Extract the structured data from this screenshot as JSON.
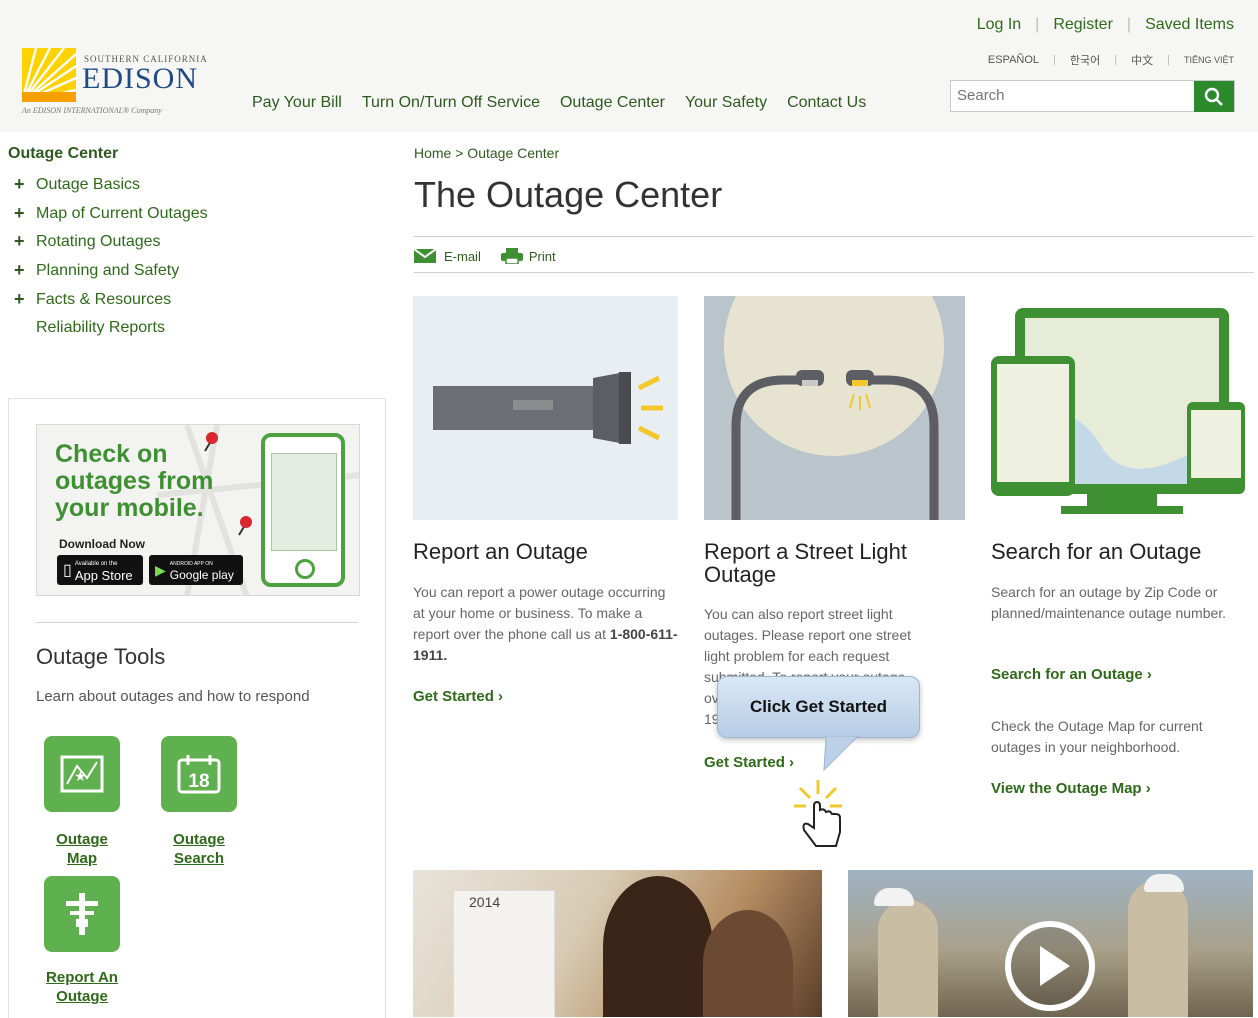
{
  "header": {
    "logo": {
      "small_top": "SOUTHERN CALIFORNIA",
      "brand": "EDISON",
      "tagline": "An EDISON INTERNATIONAL® Company"
    },
    "util_links": [
      "Log In",
      "Register",
      "Saved Items"
    ],
    "languages": [
      "ESPAÑOL",
      "한국어",
      "中文",
      "TIẾNG VIỆT"
    ],
    "nav": [
      "Pay Your Bill",
      "Turn On/Turn Off Service",
      "Outage Center",
      "Your Safety",
      "Contact Us"
    ],
    "search": {
      "placeholder": "Search",
      "icon": "search-icon"
    }
  },
  "sidebar": {
    "title": "Outage Center",
    "items": [
      {
        "label": "Outage Basics",
        "expandable": true
      },
      {
        "label": "Map of Current Outages",
        "expandable": true
      },
      {
        "label": "Rotating Outages",
        "expandable": true
      },
      {
        "label": "Planning and Safety",
        "expandable": true
      },
      {
        "label": "Facts & Resources",
        "expandable": true
      },
      {
        "label": "Reliability Reports",
        "expandable": false
      }
    ],
    "promo": {
      "line1": "Check on",
      "line2": "outages from",
      "line3": "your mobile.",
      "download": "Download Now",
      "app_store": "App Store",
      "app_store_small": "Available on the",
      "google_play": "Google play",
      "google_small": "ANDROID APP ON"
    },
    "tools": {
      "heading": "Outage Tools",
      "sub": "Learn about outages and how to respond",
      "items": [
        {
          "label_1": "Outage",
          "label_2": "Map",
          "icon": "map-icon"
        },
        {
          "label_1": "Outage",
          "label_2": "Search",
          "icon": "calendar-icon",
          "icon_text": "18"
        },
        {
          "label_1": "Report An",
          "label_2": "Outage",
          "icon": "power-pole-icon"
        }
      ]
    }
  },
  "main": {
    "breadcrumb": "Home > Outage Center",
    "title": "The Outage Center",
    "share": {
      "email": "E-mail",
      "print": "Print"
    },
    "cards": [
      {
        "title": "Report an Outage",
        "text": "You can report a power outage occurring at your home or business. To make a report over the phone call us at ",
        "phone": "1-800-611-1911.",
        "link": "Get Started"
      },
      {
        "title_1": "Report a Street Light",
        "title_2": "Outage",
        "text_lines": [
          "You can also report street light",
          "outages. Please report one street",
          "light problem for each request",
          "submitted. To report your outage",
          "over the phone, call 1-800-611-",
          "1911."
        ],
        "link": "Get Started"
      },
      {
        "title": "Search for an Outage",
        "text": "Search for an outage by Zip Code or planned/maintenance outage number.",
        "link1": "Search for an Outage",
        "text2": "Check the Outage Map for current outages in your neighborhood.",
        "link2": "View the Outage Map"
      }
    ],
    "callout": "Click Get Started",
    "photo_year": "2014"
  },
  "colors": {
    "brand_green": "#2e6a1a",
    "tile_green": "#5fb04e",
    "logo_blue": "#1f4a85",
    "search_button": "#2c8a2c"
  }
}
